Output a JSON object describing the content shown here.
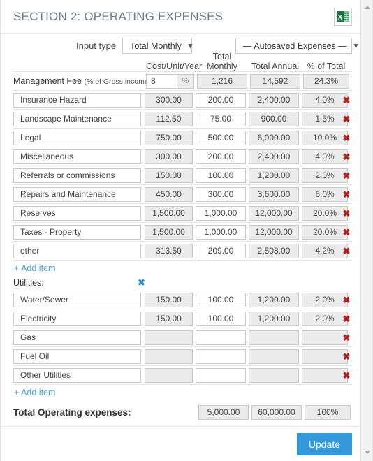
{
  "header": {
    "title": "SECTION 2: OPERATING EXPENSES",
    "export_icon": "excel-icon",
    "accent_blue": "#3498db",
    "title_color": "#6b7b8d",
    "delete_red": "#b02020"
  },
  "toolbar": {
    "input_type_label": "Input type",
    "input_type_value": "Total Monthly",
    "input_type_options": [
      "Total Monthly"
    ],
    "autosaved_value": "— Autosaved Expenses —",
    "autosaved_options": [
      "— Autosaved Expenses —"
    ],
    "chevron": "⌄"
  },
  "table": {
    "columns": [
      "Cost/Unit/Year",
      "Total Monthly",
      "Total Annual",
      "% of Total"
    ],
    "management_fee": {
      "label": "Management Fee",
      "sub_label": "(% of Gross income)",
      "percent_value": "8",
      "percent_unit": "%",
      "total_monthly": "1,216",
      "total_annual": "14,592",
      "pct_of_total": "24.3%"
    },
    "rows": [
      {
        "name": "Insurance Hazard",
        "cuy": "300.00",
        "monthly": "200.00",
        "annual": "2,400.00",
        "pct": "4.0%"
      },
      {
        "name": "Landscape Maintenance",
        "cuy": "112.50",
        "monthly": "75.00",
        "annual": "900.00",
        "pct": "1.5%"
      },
      {
        "name": "Legal",
        "cuy": "750.00",
        "monthly": "500.00",
        "annual": "6,000.00",
        "pct": "10.0%"
      },
      {
        "name": "Miscellaneous",
        "cuy": "300.00",
        "monthly": "200.00",
        "annual": "2,400.00",
        "pct": "4.0%"
      },
      {
        "name": "Referrals or commissions",
        "cuy": "150.00",
        "monthly": "100.00",
        "annual": "1,200.00",
        "pct": "2.0%"
      },
      {
        "name": "Repairs and Maintenance",
        "cuy": "450.00",
        "monthly": "300.00",
        "annual": "3,600.00",
        "pct": "6.0%"
      },
      {
        "name": "Reserves",
        "cuy": "1,500.00",
        "monthly": "1,000.00",
        "annual": "12,000.00",
        "pct": "20.0%"
      },
      {
        "name": "Taxes - Property",
        "cuy": "1,500.00",
        "monthly": "1,000.00",
        "annual": "12,000.00",
        "pct": "20.0%"
      },
      {
        "name": "other",
        "cuy": "313.50",
        "monthly": "209.00",
        "annual": "2,508.00",
        "pct": "4.2%"
      }
    ],
    "add_item_label": "+ Add item",
    "utilities": {
      "label": "Utilities:",
      "delete_icon": "remove-group-icon",
      "rows": [
        {
          "name": "Water/Sewer",
          "cuy": "150.00",
          "monthly": "100.00",
          "annual": "1,200.00",
          "pct": "2.0%"
        },
        {
          "name": "Electricity",
          "cuy": "150.00",
          "monthly": "100.00",
          "annual": "1,200.00",
          "pct": "2.0%"
        },
        {
          "name": "Gas",
          "cuy": "",
          "monthly": "",
          "annual": "",
          "pct": ""
        },
        {
          "name": "Fuel Oil",
          "cuy": "",
          "monthly": "",
          "annual": "",
          "pct": ""
        },
        {
          "name": "Other Utilities",
          "cuy": "",
          "monthly": "",
          "annual": "",
          "pct": ""
        }
      ],
      "add_item_label": "+ Add item"
    },
    "total": {
      "label": "Total Operating expenses:",
      "monthly": "5,000.00",
      "annual": "60,000.00",
      "pct": "100%"
    },
    "delete_icon": "✖"
  },
  "footer": {
    "update_label": "Update"
  }
}
